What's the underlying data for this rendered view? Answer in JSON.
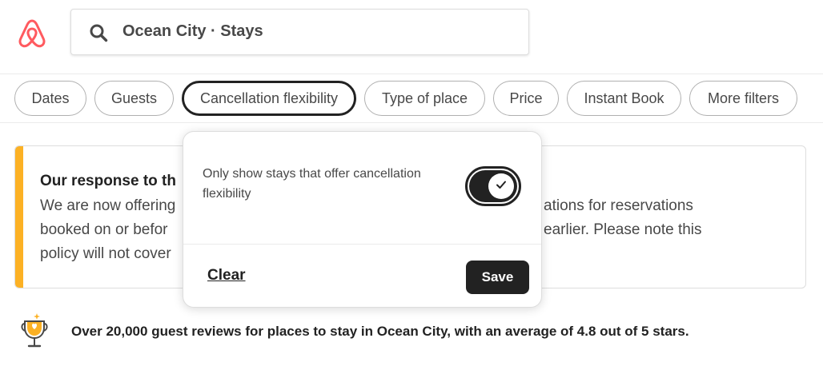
{
  "brand": {
    "logo_icon": "airbnb-logo-icon",
    "color": "#ff5a5f"
  },
  "search": {
    "icon": "search-icon",
    "text": "Ocean City · Stays"
  },
  "filters": [
    {
      "label": "Dates",
      "active": false
    },
    {
      "label": "Guests",
      "active": false
    },
    {
      "label": "Cancellation flexibility",
      "active": true
    },
    {
      "label": "Type of place",
      "active": false
    },
    {
      "label": "Price",
      "active": false
    },
    {
      "label": "Instant Book",
      "active": false
    },
    {
      "label": "More filters",
      "active": false
    }
  ],
  "alert": {
    "accent_color": "#fcb124",
    "title": "Our response to th",
    "body_lines": [
      "We are now offering",
      "ations for reservations",
      "booked on or befor",
      "earlier. Please note this",
      "policy will not cover"
    ]
  },
  "popover": {
    "description": "Only show stays that offer cancellation flexibility",
    "toggle_on": true,
    "toggle_icon": "check-icon",
    "clear_label": "Clear",
    "save_label": "Save"
  },
  "reviews": {
    "icon": "trophy-icon",
    "text": "Over 20,000 guest reviews for places to stay in Ocean City, with an average of 4.8 out of 5 stars."
  }
}
